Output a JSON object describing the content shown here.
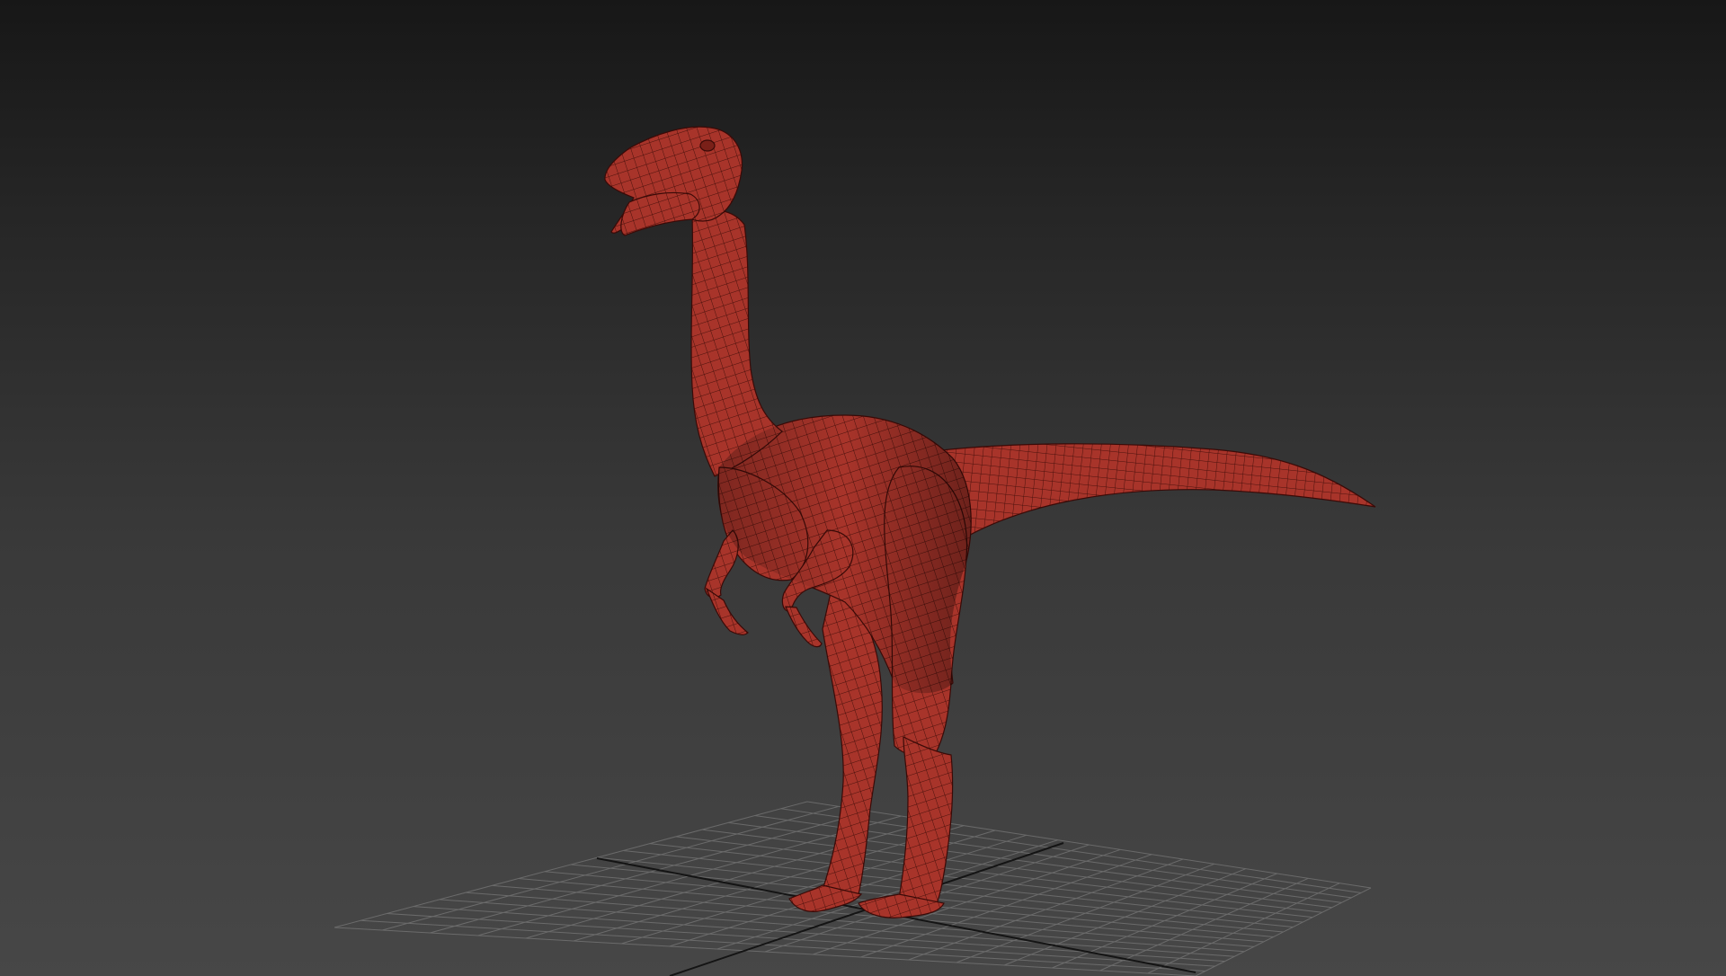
{
  "viewport": {
    "background_top": "#171717",
    "background_bottom": "#474747"
  },
  "grid": {
    "line_color": "#8a8a8a",
    "axis_color": "#141414"
  },
  "model": {
    "subject": "dinosaur-wireframe-model",
    "fill_color": "#a8342a",
    "wire_color": "#3a0a07"
  }
}
